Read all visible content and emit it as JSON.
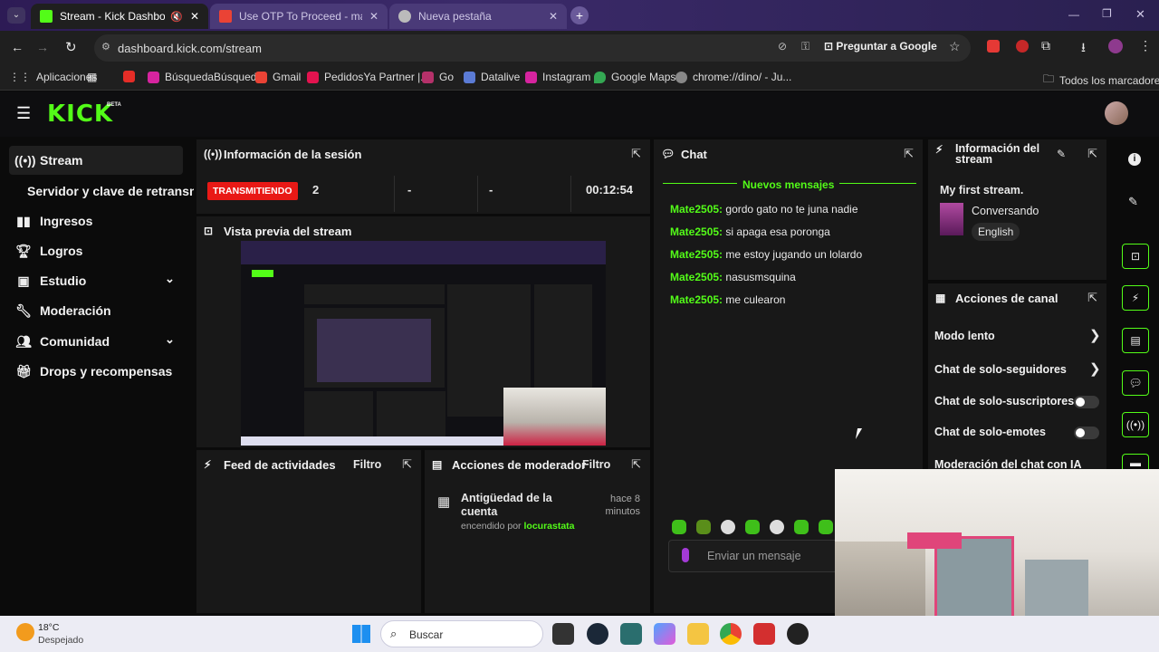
{
  "browser": {
    "tabs": [
      {
        "title": "Stream - Kick Dashboard",
        "active": true
      },
      {
        "title": "Use OTP To Proceed - matiasca"
      },
      {
        "title": "Nueva pestaña"
      }
    ],
    "url": "dashboard.kick.com/stream",
    "ask_google": "Preguntar a Google",
    "bookmarks": [
      "Aplicaciones",
      "BúsquedaBúsqueda",
      "Gmail",
      "PedidosYa Partner |...",
      "Go",
      "Datalive",
      "Instagram",
      "Google Maps",
      "chrome://dino/ - Ju..."
    ],
    "all_bookmarks": "Todos los marcadores"
  },
  "app": {
    "logo": "KICK",
    "beta": "BETA",
    "sidebar": [
      {
        "label": "Stream",
        "icon": "broadcast-icon",
        "active": true
      },
      {
        "label": "Servidor y clave de retransm"
      },
      {
        "label": "Ingresos",
        "icon": "chart-icon"
      },
      {
        "label": "Logros",
        "icon": "trophy-icon"
      },
      {
        "label": "Estudio",
        "icon": "studio-icon",
        "chevron": true
      },
      {
        "label": "Moderación",
        "icon": "wrench-icon"
      },
      {
        "label": "Comunidad",
        "icon": "people-icon",
        "chevron": true
      },
      {
        "label": "Drops y recompensas",
        "icon": "gift-icon"
      }
    ],
    "session": {
      "title": "Información de la sesión",
      "status": "TRANSMITIENDO",
      "viewers": "2",
      "stat2": "-",
      "stat3": "-",
      "duration": "00:12:54"
    },
    "preview": {
      "title": "Vista previa del stream"
    },
    "activity": {
      "title": "Feed de actividades",
      "filter": "Filtro"
    },
    "mod_actions": {
      "title": "Acciones de moderador",
      "filter": "Filtro",
      "item_title": "Antigüedad de la cuenta",
      "item_by": "encendido por",
      "item_user": "locurastata",
      "item_time": "hace 8 minutos"
    },
    "chat": {
      "title": "Chat",
      "new_messages": "Nuevos mensajes",
      "messages": [
        {
          "user": "Mate2505",
          "text": "gordo gato no te juna nadie"
        },
        {
          "user": "Mate2505",
          "text": "si apaga esa poronga"
        },
        {
          "user": "Mate2505",
          "text": "me estoy jugando un lolardo"
        },
        {
          "user": "Mate2505",
          "text": "nasusmsquina"
        },
        {
          "user": "Mate2505",
          "text": "me culearon"
        }
      ],
      "placeholder": "Enviar un mensaje"
    },
    "stream_info": {
      "title": "Información del stream",
      "stream_title": "My first stream.",
      "category": "Conversando",
      "language": "English"
    },
    "channel_actions": {
      "title": "Acciones de canal",
      "items": [
        {
          "label": "Modo lento",
          "type": "arrow"
        },
        {
          "label": "Chat de solo-seguidores",
          "type": "arrow"
        },
        {
          "label": "Chat de solo-suscriptores",
          "type": "toggle"
        },
        {
          "label": "Chat de solo-emotes",
          "type": "toggle"
        },
        {
          "label": "Moderación del chat con IA",
          "type": "link"
        }
      ]
    }
  },
  "taskbar": {
    "weather_temp": "18°C",
    "weather_desc": "Despejado",
    "search": "Buscar"
  },
  "colors": {
    "accent": "#53fc18",
    "live": "#e91916"
  }
}
